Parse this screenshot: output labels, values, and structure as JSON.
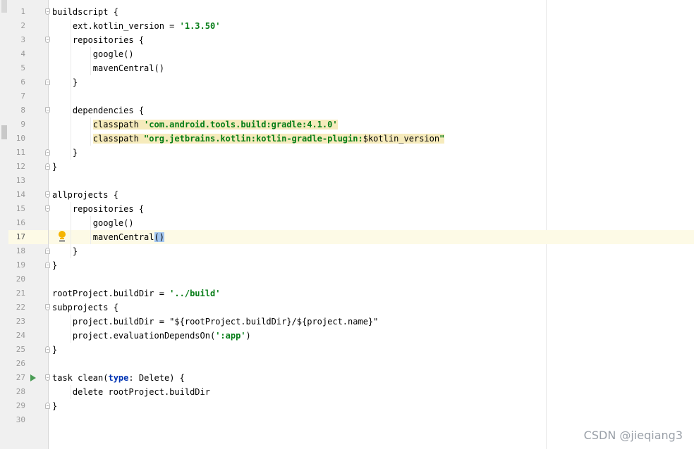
{
  "editor": {
    "current_line": 17,
    "lines": [
      {
        "no": "1",
        "fold": "open",
        "parts": [
          {
            "t": "buildscript {"
          }
        ]
      },
      {
        "no": "2",
        "parts": [
          {
            "t": "    ext.kotlin_version = "
          },
          {
            "t": "'1.3.50'",
            "c": "str"
          }
        ]
      },
      {
        "no": "3",
        "fold": "open",
        "parts": [
          {
            "t": "    repositories {"
          }
        ]
      },
      {
        "no": "4",
        "parts": [
          {
            "t": "        google()"
          }
        ]
      },
      {
        "no": "5",
        "parts": [
          {
            "t": "        mavenCentral()"
          }
        ]
      },
      {
        "no": "6",
        "fold": "close",
        "parts": [
          {
            "t": "    }"
          }
        ]
      },
      {
        "no": "7",
        "parts": [
          {
            "t": ""
          }
        ]
      },
      {
        "no": "8",
        "fold": "open",
        "parts": [
          {
            "t": "    dependencies {"
          }
        ]
      },
      {
        "no": "9",
        "highlight": true,
        "parts": [
          {
            "t": "        "
          },
          {
            "t": "classpath ",
            "bg": true
          },
          {
            "t": "'com.android.tools.build:gradle:4.1.0'",
            "c": "str",
            "bg": true
          }
        ]
      },
      {
        "no": "10",
        "highlight": true,
        "parts": [
          {
            "t": "        "
          },
          {
            "t": "classpath ",
            "bg": true
          },
          {
            "t": "\"org.jetbrains.kotlin:kotlin-gradle-plugin:",
            "c": "str",
            "bg": true
          },
          {
            "t": "$kotlin_version",
            "bg": true
          },
          {
            "t": "\"",
            "c": "str",
            "bg": true
          }
        ]
      },
      {
        "no": "11",
        "fold": "close",
        "parts": [
          {
            "t": "    }"
          }
        ]
      },
      {
        "no": "12",
        "fold": "close",
        "parts": [
          {
            "t": "}"
          }
        ]
      },
      {
        "no": "13",
        "parts": [
          {
            "t": ""
          }
        ]
      },
      {
        "no": "14",
        "fold": "open",
        "parts": [
          {
            "t": "allprojects {"
          }
        ]
      },
      {
        "no": "15",
        "fold": "open",
        "parts": [
          {
            "t": "    repositories {"
          }
        ]
      },
      {
        "no": "16",
        "parts": [
          {
            "t": "        google()"
          }
        ]
      },
      {
        "no": "17",
        "bulb": true,
        "parts": [
          {
            "t": "        mavenCentral"
          },
          {
            "t": "()",
            "c": "brace-match"
          }
        ]
      },
      {
        "no": "18",
        "fold": "close",
        "parts": [
          {
            "t": "    }"
          }
        ]
      },
      {
        "no": "19",
        "fold": "close",
        "parts": [
          {
            "t": "}"
          }
        ]
      },
      {
        "no": "20",
        "parts": [
          {
            "t": ""
          }
        ]
      },
      {
        "no": "21",
        "parts": [
          {
            "t": "rootProject.buildDir = "
          },
          {
            "t": "'../build'",
            "c": "str"
          }
        ]
      },
      {
        "no": "22",
        "fold": "open",
        "parts": [
          {
            "t": "subprojects {"
          }
        ]
      },
      {
        "no": "23",
        "parts": [
          {
            "t": "    project.buildDir = \"${rootProject.buildDir}/${project.name}\""
          }
        ]
      },
      {
        "no": "24",
        "parts": [
          {
            "t": "    project.evaluationDependsOn("
          },
          {
            "t": "':app'",
            "c": "str"
          },
          {
            "t": ")"
          }
        ]
      },
      {
        "no": "25",
        "fold": "close",
        "parts": [
          {
            "t": "}"
          }
        ]
      },
      {
        "no": "26",
        "parts": [
          {
            "t": ""
          }
        ]
      },
      {
        "no": "27",
        "run": true,
        "fold": "open",
        "parts": [
          {
            "t": "task clean("
          },
          {
            "t": "type",
            "c": "kwb"
          },
          {
            "t": ": Delete) {"
          }
        ]
      },
      {
        "no": "28",
        "parts": [
          {
            "t": "    delete rootProject.buildDir"
          }
        ]
      },
      {
        "no": "29",
        "fold": "close",
        "parts": [
          {
            "t": "}"
          }
        ]
      },
      {
        "no": "30",
        "parts": [
          {
            "t": ""
          }
        ]
      }
    ]
  },
  "watermark": "CSDN @jieqiang3",
  "icons": {
    "fold": "fold-marker-icon",
    "run": "run-gutter-icon",
    "intention": "lightbulb-icon"
  },
  "colors": {
    "string": "#067d17",
    "keyword": "#0033b3",
    "current_line": "#fdfae6",
    "highlight_bg": "#f6ebbc",
    "brace_match": "#a3c6f0",
    "run_icon": "#499c54",
    "bulb": "#f5b400"
  }
}
